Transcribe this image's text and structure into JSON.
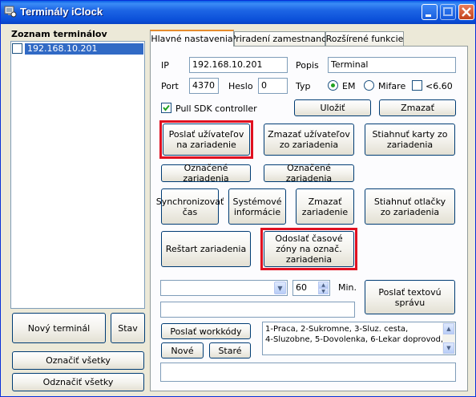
{
  "window": {
    "title": "Terminály iClock"
  },
  "left": {
    "list_title": "Zoznam terminálov",
    "items": [
      {
        "label": "192.168.10.201",
        "checked": false
      }
    ],
    "new_terminal": "Nový terminál",
    "status": "Stav",
    "check_all": "Označiť všetky",
    "uncheck_all": "Odznačiť všetky"
  },
  "tabs": [
    "Hlavné nastavenia",
    "Priradení zamestnanci",
    "Rozšírené funkcie"
  ],
  "form": {
    "ip_label": "IP",
    "ip_value": "192.168.10.201",
    "desc_label": "Popis",
    "desc_value": "Terminal",
    "port_label": "Port",
    "port_value": "4370",
    "pass_label": "Heslo",
    "pass_value": "0",
    "type_label": "Typ",
    "type_em": "EM",
    "type_mifare": "Mifare",
    "type_660": "<6.60",
    "type_selected": "EM",
    "pull_sdk": "Pull SDK controller",
    "pull_sdk_checked": true,
    "save": "Uložiť",
    "delete": "Zmazať"
  },
  "actions": {
    "send_users": "Poslať užívateľov na zariadenie",
    "delete_users": "Zmazať užívateľov zo zariadenia",
    "download_cards": "Stiahnuť karty zo zariadenia",
    "marked1": "Označené zariadenia",
    "marked2": "Označené zariadenia",
    "sync_time": "Synchronizovať čas",
    "sys_info": "Systémové informácie",
    "delete_device": "Zmazať zariadenie",
    "download_fp": "Stiahnuť otlačky zo zariadenia",
    "restart": "Reštart zariadenia",
    "send_timezones": "Odoslať časové zóny na označ. zariadenia"
  },
  "message": {
    "minutes_value": "60",
    "minutes_label": "Min.",
    "send_text": "Poslať textovú správu"
  },
  "workcodes": {
    "send": "Poslať workkódy",
    "new": "Nové",
    "old": "Staré",
    "list_line1": "1-Praca, 2-Sukromne, 3-Sluz. cesta,",
    "list_line2": "4-Sluzobne, 5-Dovolenka, 6-Lekar doprovod,"
  },
  "colors": {
    "titlebar": "#0a4ed8",
    "selection": "#316ac5",
    "highlight_border": "#e01020"
  }
}
